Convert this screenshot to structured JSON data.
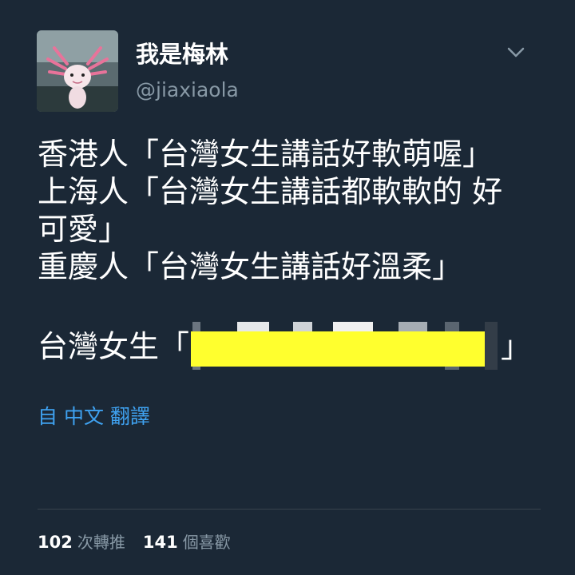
{
  "user": {
    "display_name": "我是梅林",
    "handle": "@jiaxiaola",
    "avatar_icon": "axolotl-avatar"
  },
  "menu_icon": "chevron-down-icon",
  "tweet": {
    "lines": [
      "香港人「台灣女生講話好軟萌喔」",
      "上海人「台灣女生講話都軟軟的 好",
      "可愛」",
      "重慶人「台灣女生講話好溫柔」"
    ],
    "censored_line": {
      "prefix": "台灣女生「",
      "suffix": "」",
      "censor_color": "#ffff2e"
    }
  },
  "translate_label": "自 中文 翻譯",
  "stats": {
    "retweets": {
      "count": "102",
      "label": "次轉推"
    },
    "likes": {
      "count": "141",
      "label": "個喜歡"
    }
  },
  "colors": {
    "background": "#1b2836",
    "accent": "#3fa2f1",
    "muted": "#8899a6"
  }
}
